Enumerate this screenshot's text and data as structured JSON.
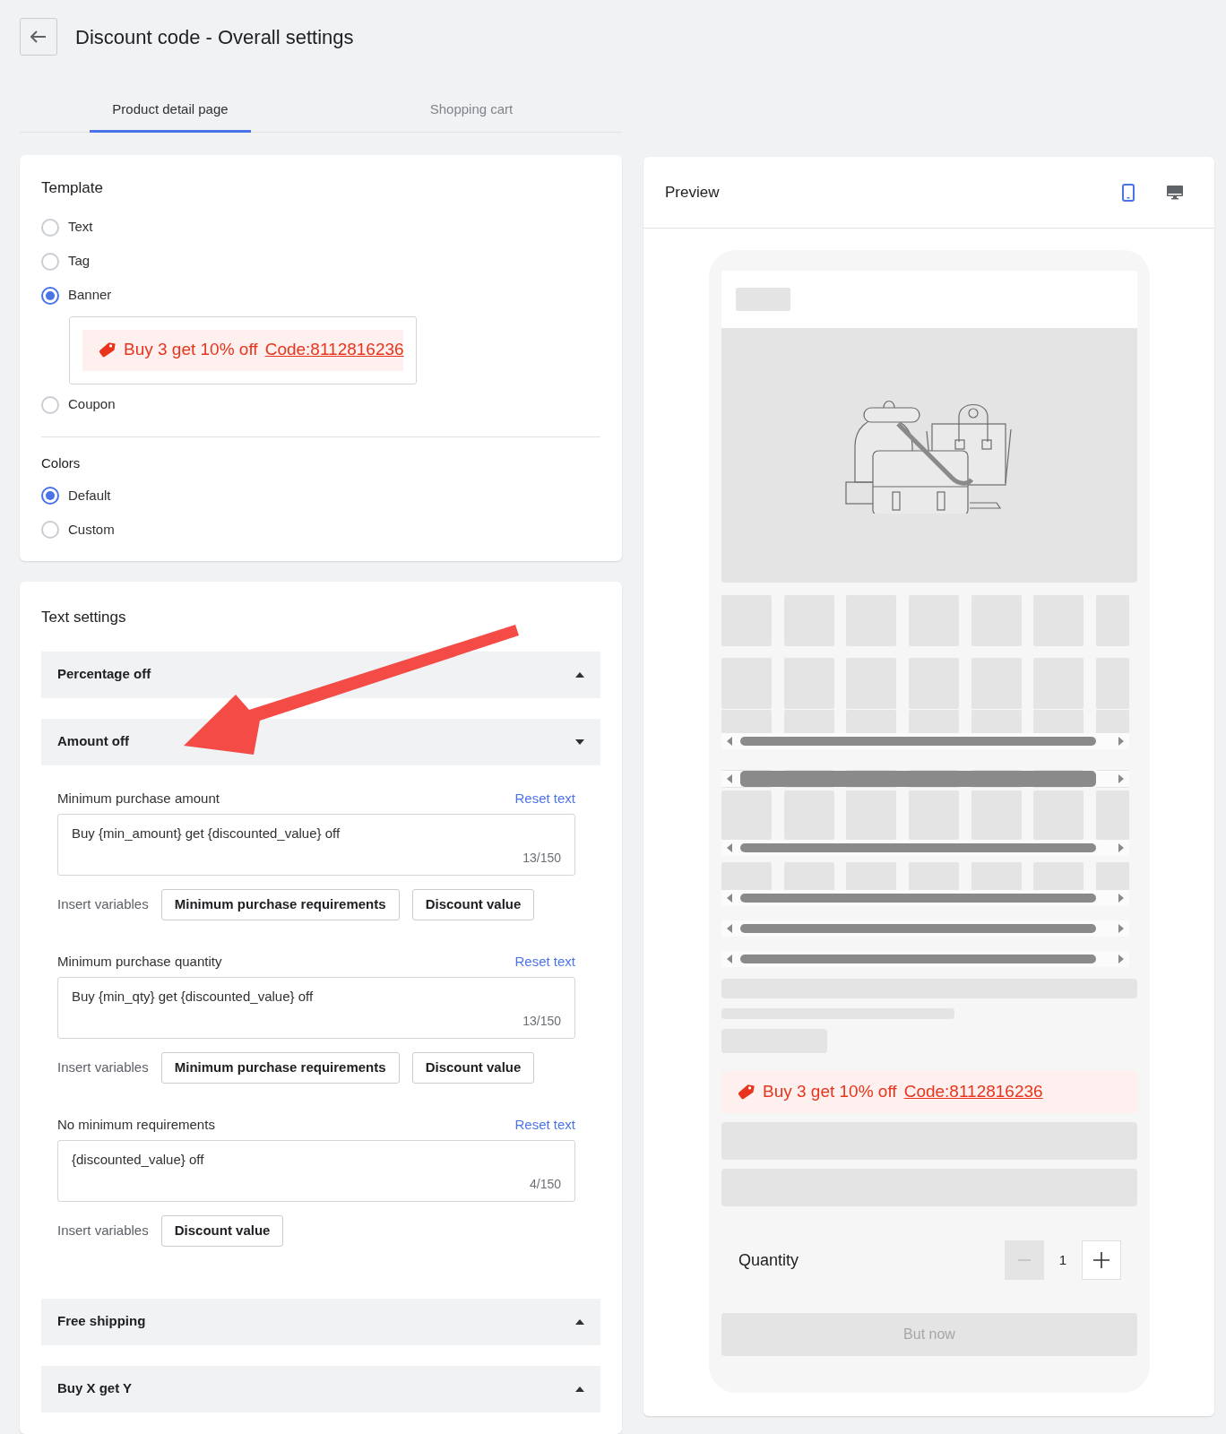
{
  "header": {
    "title": "Discount code - Overall settings"
  },
  "tabs": [
    {
      "label": "Product detail page",
      "selected": true
    },
    {
      "label": "Shopping cart",
      "selected": false
    }
  ],
  "template": {
    "title": "Template",
    "options": [
      {
        "label": "Text",
        "selected": false
      },
      {
        "label": "Tag",
        "selected": false
      },
      {
        "label": "Banner",
        "selected": true,
        "sample": {
          "text": "Buy 3 get 10% off",
          "code": "Code:8112816236"
        }
      },
      {
        "label": "Coupon",
        "selected": false
      }
    ]
  },
  "colors": {
    "title": "Colors",
    "options": [
      {
        "label": "Default",
        "selected": true
      },
      {
        "label": "Custom",
        "selected": false
      }
    ]
  },
  "text_settings": {
    "title": "Text settings",
    "sections": [
      {
        "label": "Percentage off",
        "expanded": false
      },
      {
        "label": "Amount off",
        "expanded": true,
        "fields": [
          {
            "label": "Minimum purchase amount",
            "reset": "Reset text",
            "value": "Buy {min_amount} get {discounted_value} off",
            "count": "13/150",
            "insert_label": "Insert variables",
            "variables": [
              "Minimum purchase requirements",
              "Discount value"
            ]
          },
          {
            "label": "Minimum purchase quantity",
            "reset": "Reset text",
            "value": "Buy {min_qty} get {discounted_value} off",
            "count": "13/150",
            "insert_label": "Insert variables",
            "variables": [
              "Minimum purchase requirements",
              "Discount value"
            ]
          },
          {
            "label": "No minimum requirements",
            "reset": "Reset text",
            "value": "{discounted_value} off",
            "count": "4/150",
            "insert_label": "Insert variables",
            "variables": [
              "Discount value"
            ]
          }
        ]
      },
      {
        "label": "Free shipping",
        "expanded": false
      },
      {
        "label": "Buy X get Y",
        "expanded": false
      }
    ]
  },
  "preview": {
    "title": "Preview",
    "devices": [
      {
        "kind": "mobile",
        "selected": true
      },
      {
        "kind": "desktop",
        "selected": false
      }
    ],
    "banner": {
      "text": "Buy 3 get 10% off",
      "code": "Code:8112816236"
    },
    "quantity_label": "Quantity",
    "quantity": "1",
    "buy_button": "But now"
  }
}
